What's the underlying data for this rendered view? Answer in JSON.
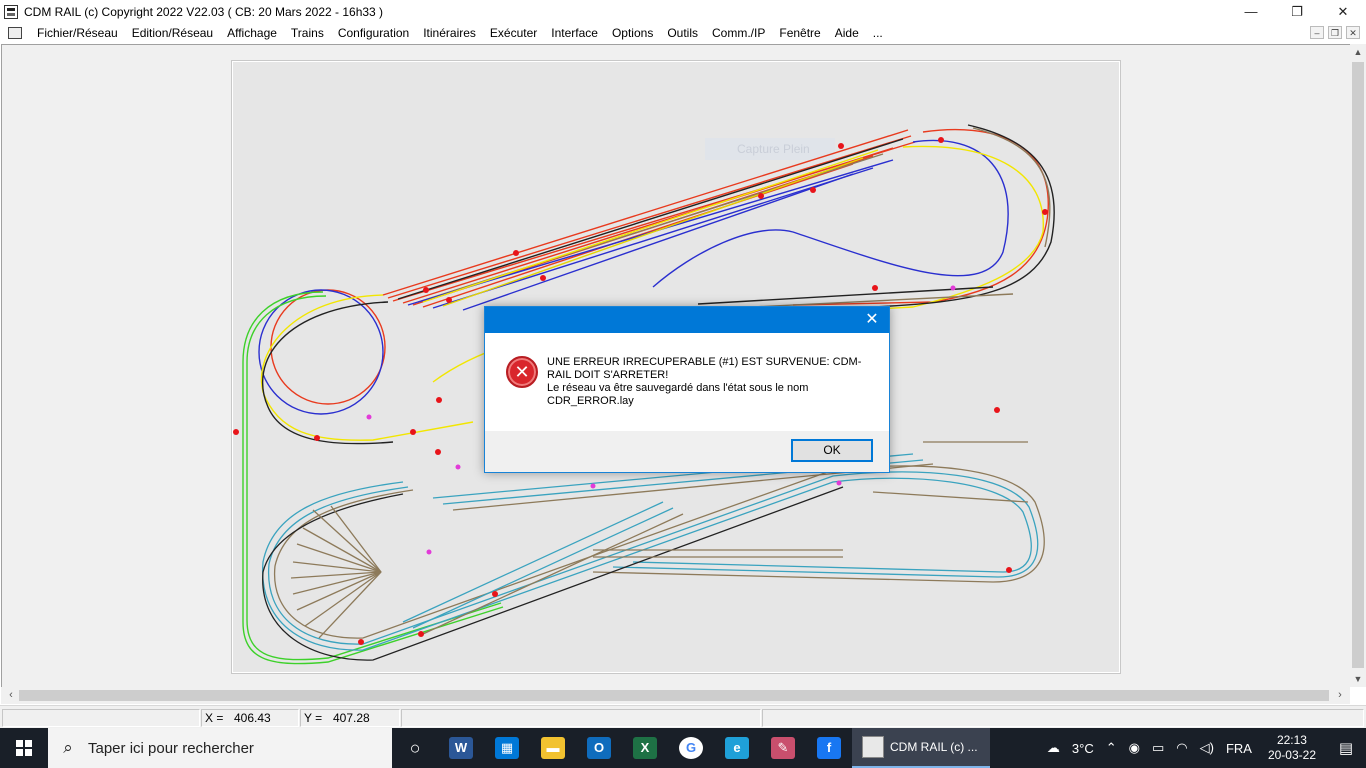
{
  "window": {
    "title": "CDM RAIL (c) Copyright 2022 V22.03 ( CB: 20 Mars 2022 - 16h33 )",
    "minimize": "—",
    "restore": "❐",
    "close": "✕"
  },
  "menu": {
    "items": [
      "Fichier/Réseau",
      "Edition/Réseau",
      "Affichage",
      "Trains",
      "Configuration",
      "Itinéraires",
      "Exécuter",
      "Interface",
      "Options",
      "Outils",
      "Comm./IP",
      "Fenêtre",
      "Aide",
      "..."
    ],
    "mdi_minimize": "–",
    "mdi_restore": "❐",
    "mdi_close": "✕"
  },
  "canvas": {
    "ghost_label": "Capture Plein",
    "track_colors": {
      "red": "#e83a1e",
      "blue": "#2a2fcf",
      "yellow": "#f2e600",
      "green": "#3dd12a",
      "black": "#222222",
      "teal": "#3aa3bf",
      "tan": "#8d7a5a"
    }
  },
  "statusbar": {
    "x_label": "X =",
    "x_value": "406.43",
    "y_label": "Y =",
    "y_value": "407.28"
  },
  "dialog": {
    "close": "✕",
    "message_line1": "UNE ERREUR IRRECUPERABLE (#1) EST SURVENUE: CDM-RAIL DOIT S'ARRETER!",
    "message_line2": "Le réseau va être sauvegardé dans l'état sous le nom CDR_ERROR.lay",
    "ok_label": "OK",
    "icon": "error-icon"
  },
  "taskbar": {
    "search_placeholder": "Taper ici pour rechercher",
    "pinned": [
      {
        "name": "task-view-icon",
        "glyph": "○",
        "color": "transparent"
      },
      {
        "name": "word-icon",
        "glyph": "W",
        "color": "#2b5797"
      },
      {
        "name": "store-icon",
        "glyph": "▦",
        "color": "#0078d7"
      },
      {
        "name": "file-explorer-icon",
        "glyph": "▬",
        "color": "#f2c230"
      },
      {
        "name": "outlook-icon",
        "glyph": "O",
        "color": "#0f6cbd"
      },
      {
        "name": "excel-icon",
        "glyph": "X",
        "color": "#1e7145"
      },
      {
        "name": "chrome-icon",
        "glyph": "G",
        "color": "#ffffff"
      },
      {
        "name": "edge-icon",
        "glyph": "e",
        "color": "#1fa0d8"
      },
      {
        "name": "paint-icon",
        "glyph": "✎",
        "color": "#c94f6d"
      },
      {
        "name": "facebook-icon",
        "glyph": "f",
        "color": "#1877f2"
      }
    ],
    "active_app_label": "CDM RAIL (c) ...",
    "weather": "3°C",
    "language": "FRA",
    "time": "22:13",
    "date": "20-03-22"
  }
}
